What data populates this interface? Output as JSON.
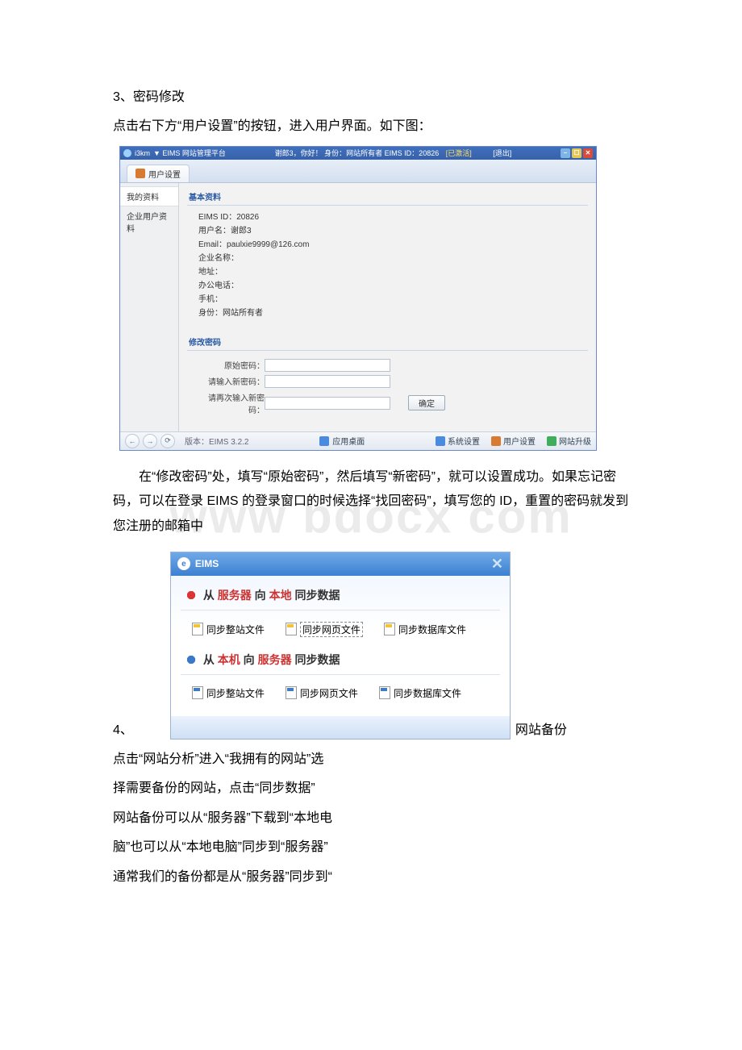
{
  "doc": {
    "h3": "3、密码修改",
    "p1": "点击右下方“用户设置”的按钮，进入用户界面。如下图：",
    "p2": "在“修改密码”处，填写“原始密码”，然后填写“新密码”，就可以设置成功。如果忘记密码，可以在登录 EIMS 的登录窗口的时候选择“找回密码”，填写您的 ID，重置的密码就发到您注册的邮箱中",
    "h4_num": "4、",
    "h4_tail": "网站备份",
    "p3": "点击“网站分析”进入“我拥有的网站”选",
    "p4": "择需要备份的网站，点击“同步数据”",
    "p5": "网站备份可以从“服务器”下载到“本地电",
    "p6": "脑”也可以从“本地电脑”同步到“服务器”",
    "p7": "通常我们的备份都是从“服务器”同步到“",
    "watermark": "www bdocx com"
  },
  "app": {
    "title_left": "i3km",
    "title_sub": "▼ EIMS 网站管理平台",
    "title_user": "谢郎3，你好！  身份：网站所有者  EIMS ID：20826",
    "title_activated": "[已激活]",
    "title_logout": "[退出]",
    "tab": "用户设置",
    "side1": "我的资料",
    "side2": "企业用户资料",
    "sec_basic": "基本资料",
    "kv_id": "EIMS ID：20826",
    "kv_user": "用户名：谢郎3",
    "kv_email": "Email：paulxie9999@126.com",
    "kv_company": "企业名称：",
    "kv_addr": "地址：",
    "kv_tel": "办公电话：",
    "kv_mobile": "手机：",
    "kv_role": "身份：网站所有者",
    "sec_pw": "修改密码",
    "pw_old": "原始密码：",
    "pw_new": "请输入新密码：",
    "pw_new2": "请再次输入新密码：",
    "pw_confirm": "确定",
    "version": "版本：EIMS 3.2.2",
    "sb_desktop": "应用桌面",
    "sb_sys": "系统设置",
    "sb_user": "用户设置",
    "sb_upgrade": "网站升级"
  },
  "dialog": {
    "title": "EIMS",
    "h1_pre": "从 ",
    "h1_a": "服务器",
    "h1_mid": " 向 ",
    "h1_b": "本地",
    "h1_post": " 同步数据",
    "h2_pre": "从 ",
    "h2_a": "本机",
    "h2_mid": " 向 ",
    "h2_b": "服务器",
    "h2_post": " 同步数据",
    "opt_all": "同步整站文件",
    "opt_web": "同步网页文件",
    "opt_db": "同步数据库文件"
  }
}
